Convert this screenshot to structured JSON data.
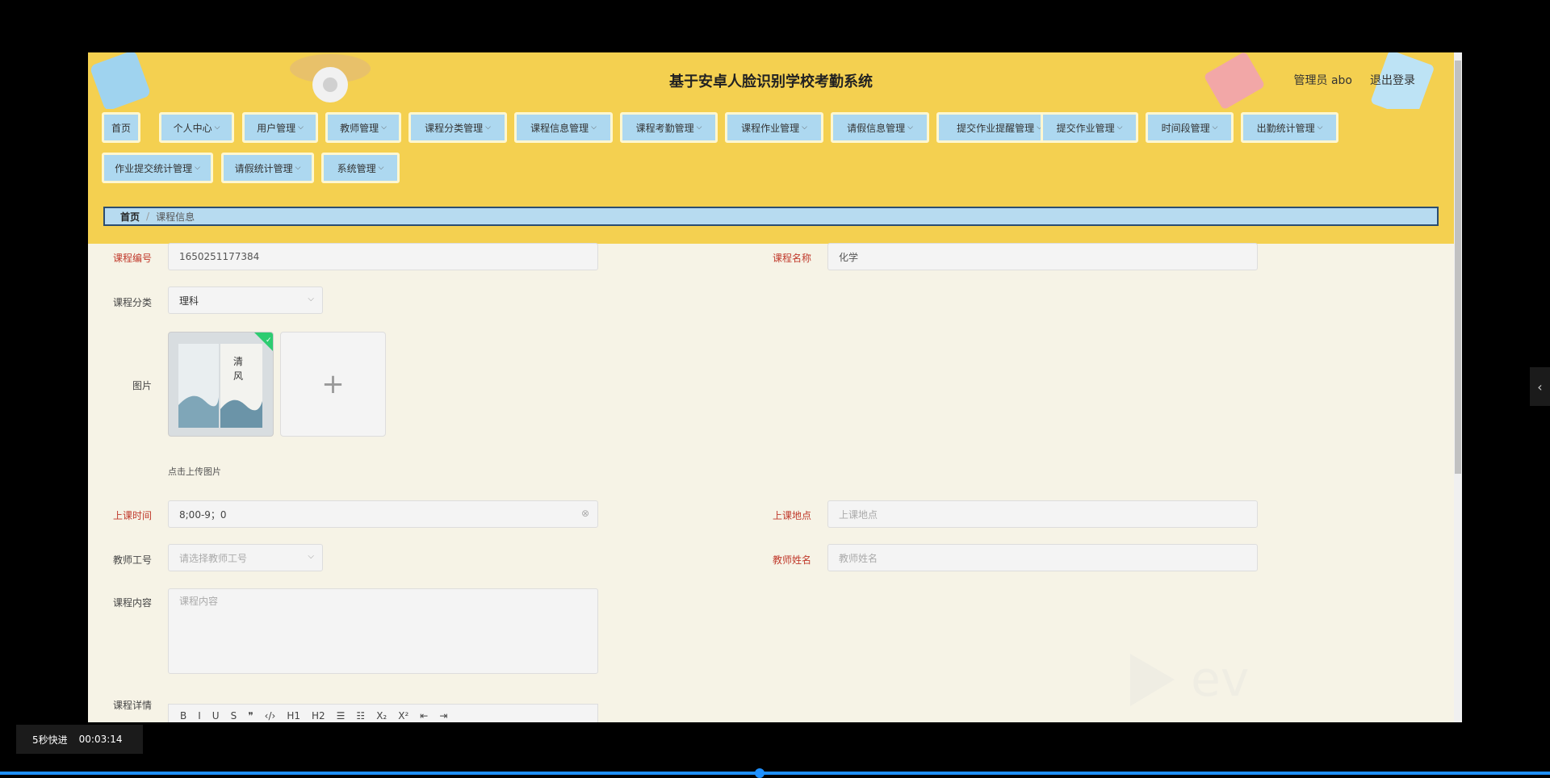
{
  "header": {
    "title": "基于安卓人脸识别学校考勤系统",
    "user_label": "管理员 abo",
    "logout_label": "退出登录"
  },
  "nav": {
    "items": [
      {
        "label": "首页",
        "has_menu": false
      },
      {
        "label": "个人中心",
        "has_menu": true
      },
      {
        "label": "用户管理",
        "has_menu": true
      },
      {
        "label": "教师管理",
        "has_menu": true
      },
      {
        "label": "课程分类管理",
        "has_menu": true
      },
      {
        "label": "课程信息管理",
        "has_menu": true
      },
      {
        "label": "课程考勤管理",
        "has_menu": true
      },
      {
        "label": "课程作业管理",
        "has_menu": true
      },
      {
        "label": "请假信息管理",
        "has_menu": true
      },
      {
        "label": "提交作业提醒管理",
        "has_menu": true
      },
      {
        "label": "提交作业管理",
        "has_menu": true
      },
      {
        "label": "时间段管理",
        "has_menu": true
      },
      {
        "label": "出勤统计管理",
        "has_menu": true
      },
      {
        "label": "作业提交统计管理",
        "has_menu": true
      },
      {
        "label": "请假统计管理",
        "has_menu": true
      },
      {
        "label": "系统管理",
        "has_menu": true
      }
    ]
  },
  "breadcrumb": {
    "home": "首页",
    "separator": "/",
    "current": "课程信息"
  },
  "form": {
    "course_no": {
      "label": "课程编号",
      "value": "1650251177384"
    },
    "course_name": {
      "label": "课程名称",
      "value": "化学"
    },
    "category": {
      "label": "课程分类",
      "value": "理科"
    },
    "image": {
      "label": "图片",
      "hint": "点击上传图片",
      "add_symbol": "+"
    },
    "class_time": {
      "label": "上课时间",
      "value": "8;00-9；0"
    },
    "class_place": {
      "label": "上课地点",
      "placeholder": "上课地点"
    },
    "teacher_no": {
      "label": "教师工号",
      "placeholder": "请选择教师工号"
    },
    "teacher_name": {
      "label": "教师姓名",
      "placeholder": "教师姓名"
    },
    "content": {
      "label": "课程内容",
      "placeholder": "课程内容"
    },
    "detail": {
      "label": "课程详情"
    }
  },
  "editor_toolbar": [
    "B",
    "I",
    "U",
    "S",
    "❞",
    "‹/›",
    "H1",
    "H2",
    "☰",
    "☷",
    "X₂",
    "X²",
    "⇤",
    "⇥"
  ],
  "player": {
    "speed_label": "5秒快进",
    "time": "00:03:14",
    "progress_fraction": 0.49
  },
  "colors": {
    "header_bg": "#f4d050",
    "nav_item_bg": "#add8f0",
    "required_label": "#c0392b",
    "progress": "#1e90ff"
  }
}
